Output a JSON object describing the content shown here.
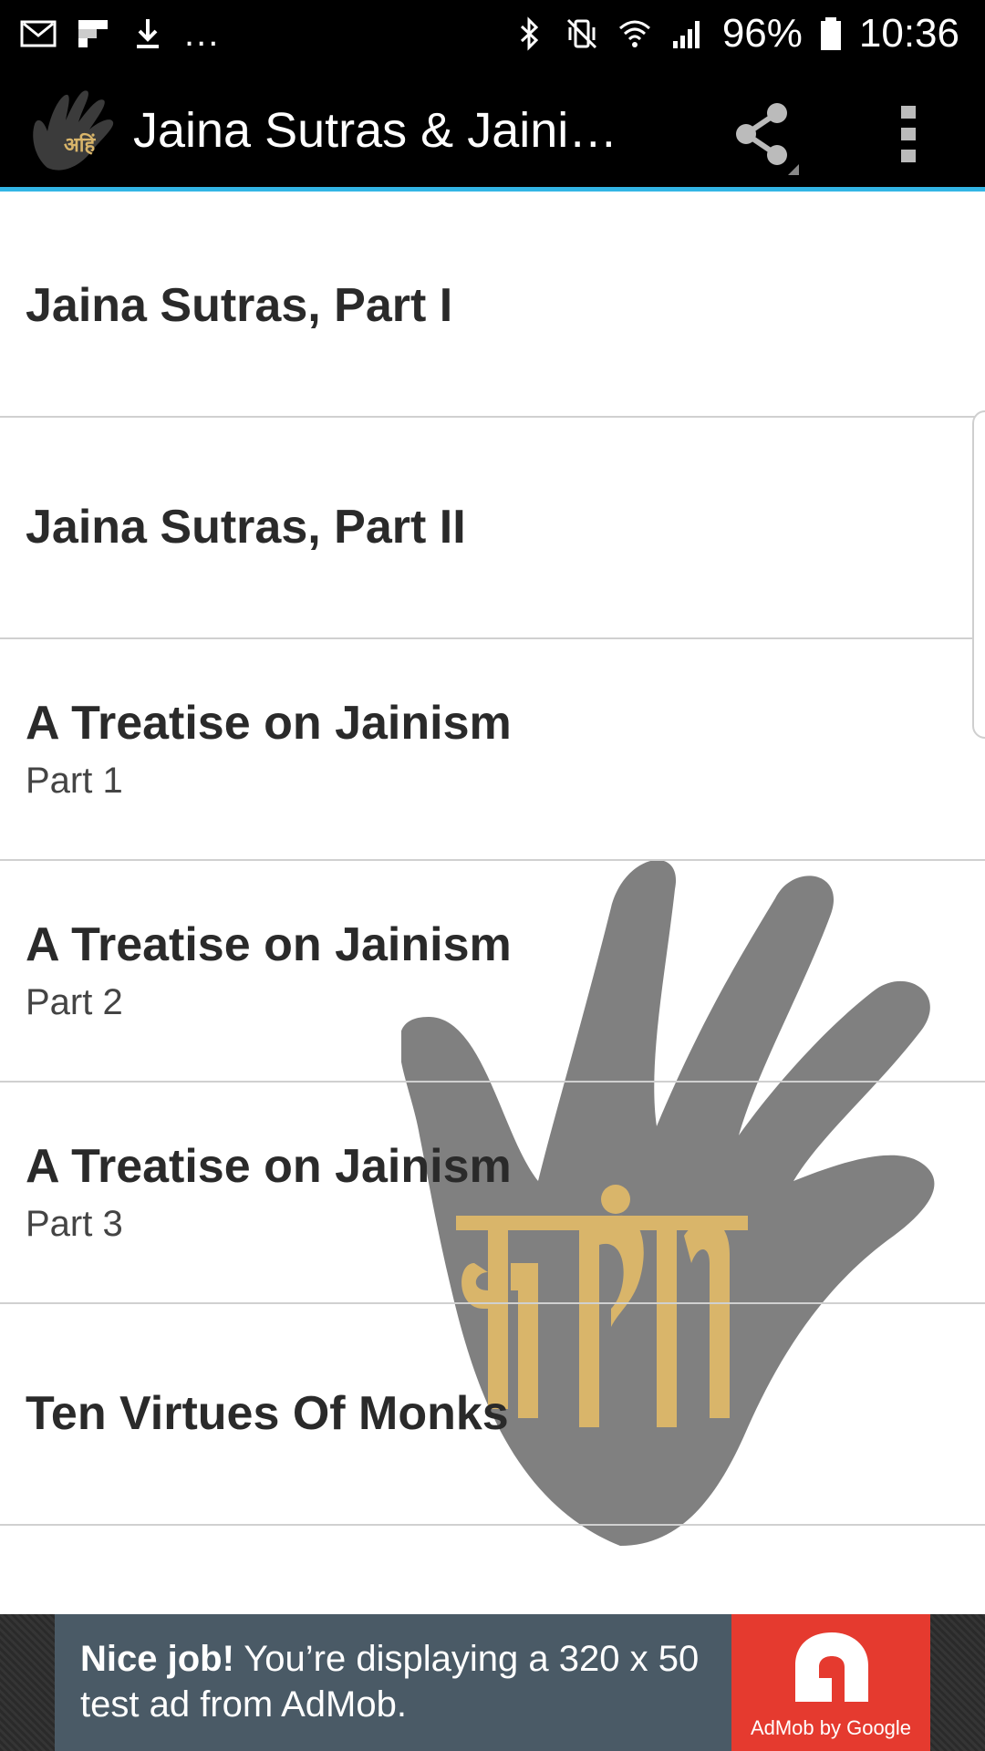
{
  "status_bar": {
    "dots": "...",
    "battery_percent": "96%",
    "time": "10:36",
    "icons": [
      "gmail-icon",
      "flipboard-icon",
      "download-icon",
      "bluetooth-icon",
      "vibrate-icon",
      "wifi-icon",
      "signal-icon",
      "battery-icon"
    ]
  },
  "action_bar": {
    "title": "Jaina Sutras & Jainis...",
    "share_icon": "share-icon",
    "overflow_icon": "overflow-menu-icon",
    "accent_color": "#33b5e5"
  },
  "list": {
    "items": [
      {
        "title": "Jaina Sutras, Part I",
        "subtitle": ""
      },
      {
        "title": "Jaina Sutras, Part II",
        "subtitle": ""
      },
      {
        "title": "A Treatise on Jainism",
        "subtitle": "Part 1"
      },
      {
        "title": "A Treatise on Jainism",
        "subtitle": "Part 2"
      },
      {
        "title": "A Treatise on Jainism",
        "subtitle": "Part 3"
      },
      {
        "title": "Ten Virtues Of Monks",
        "subtitle": ""
      }
    ]
  },
  "background": {
    "image": "ahimsa-hand-icon",
    "hand_color": "#808080",
    "emblem_color": "#d9b56a"
  },
  "ad": {
    "headline": "Nice job!",
    "body": " You’re displaying a 320 x 50 test ad from AdMob.",
    "logo_label": "AdMob by Google",
    "logo_color": "#e53a2f"
  }
}
